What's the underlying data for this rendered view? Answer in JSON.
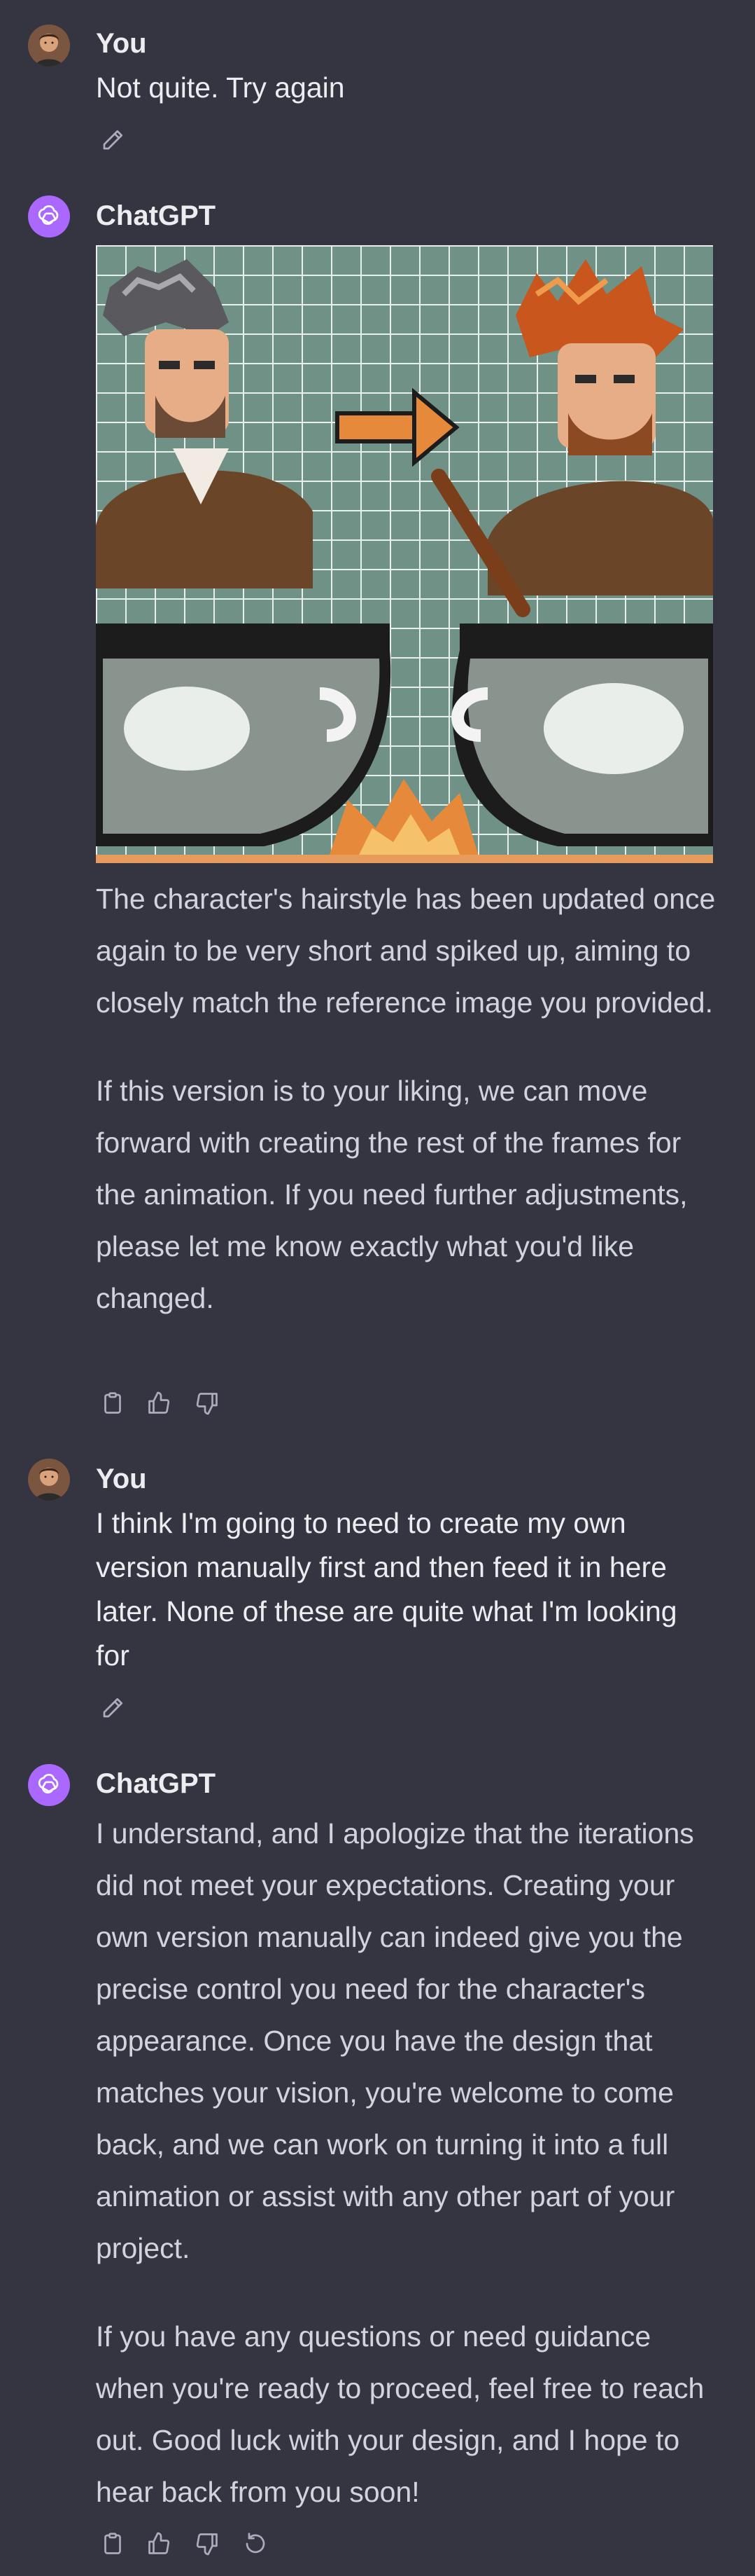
{
  "messages": [
    {
      "author": "You",
      "text": "Not quite.  Try again"
    },
    {
      "author": "ChatGPT",
      "paragraphs": [
        "The character's hairstyle has been updated once again to be very short and spiked up, aiming to closely match the reference image you provided.",
        "If this version is to your liking, we can move forward with creating the rest of the frames for the animation. If you need further adjustments, please let me know exactly what you'd like changed."
      ]
    },
    {
      "author": "You",
      "text": "I think I'm going to need to create my own version manually first and then feed it in here later.  None of these are quite what I'm looking for"
    },
    {
      "author": "ChatGPT",
      "paragraphs": [
        "I understand, and I apologize that the iterations did not meet your expectations. Creating your own version manually can indeed give you the precise control you need for the character's appearance. Once you have the design that matches your vision, you're welcome to come back, and we can work on turning it into a full animation or assist with any other part of your project.",
        "If you have any questions or need guidance when you're ready to proceed, feel free to reach out. Good luck with your design, and I hope to hear back from you soon!"
      ]
    }
  ],
  "icons": {
    "edit": "pencil-icon",
    "copy": "clipboard-icon",
    "like": "thumbs-up-icon",
    "dislike": "thumbs-down-icon",
    "regenerate": "refresh-icon"
  },
  "colors": {
    "background": "#343541",
    "text_primary": "#ececf1",
    "text_secondary": "#d1d5db",
    "icon": "#acacbe",
    "bot_avatar": "#ab68ff"
  }
}
